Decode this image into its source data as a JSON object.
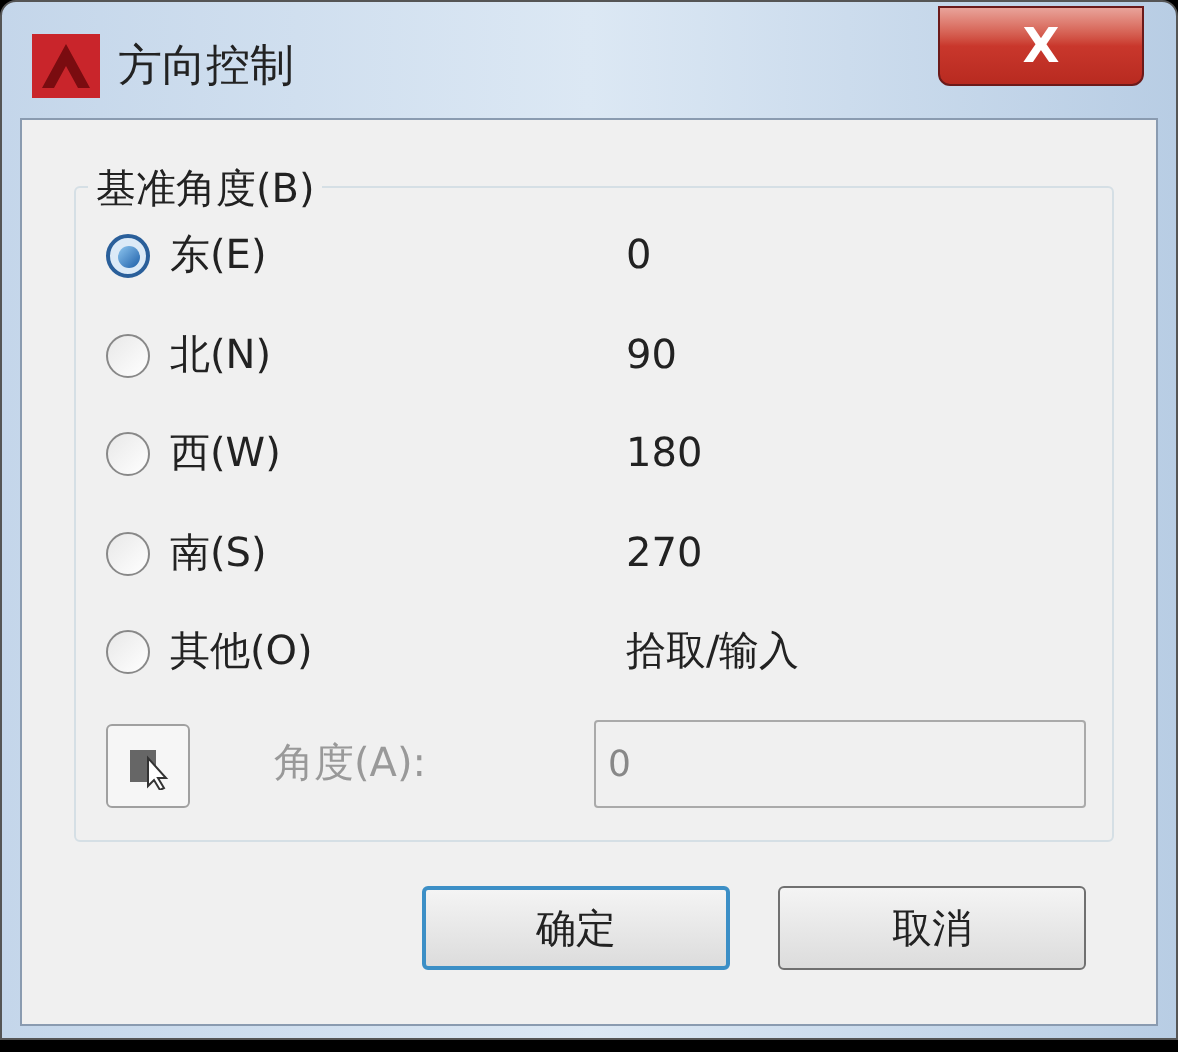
{
  "window": {
    "title": "方向控制",
    "close": "X"
  },
  "group": {
    "title": "基准角度(B)",
    "options": [
      {
        "label": "东(E)",
        "value": "0",
        "selected": true
      },
      {
        "label": "北(N)",
        "value": "90",
        "selected": false
      },
      {
        "label": "西(W)",
        "value": "180",
        "selected": false
      },
      {
        "label": "南(S)",
        "value": "270",
        "selected": false
      },
      {
        "label": "其他(O)",
        "value": "拾取/输入",
        "selected": false
      }
    ],
    "angle": {
      "label": "角度(A):",
      "value": "0",
      "disabled": true
    }
  },
  "buttons": [
    {
      "label": "确定",
      "default": true
    },
    {
      "label": "取消",
      "default": false
    }
  ]
}
